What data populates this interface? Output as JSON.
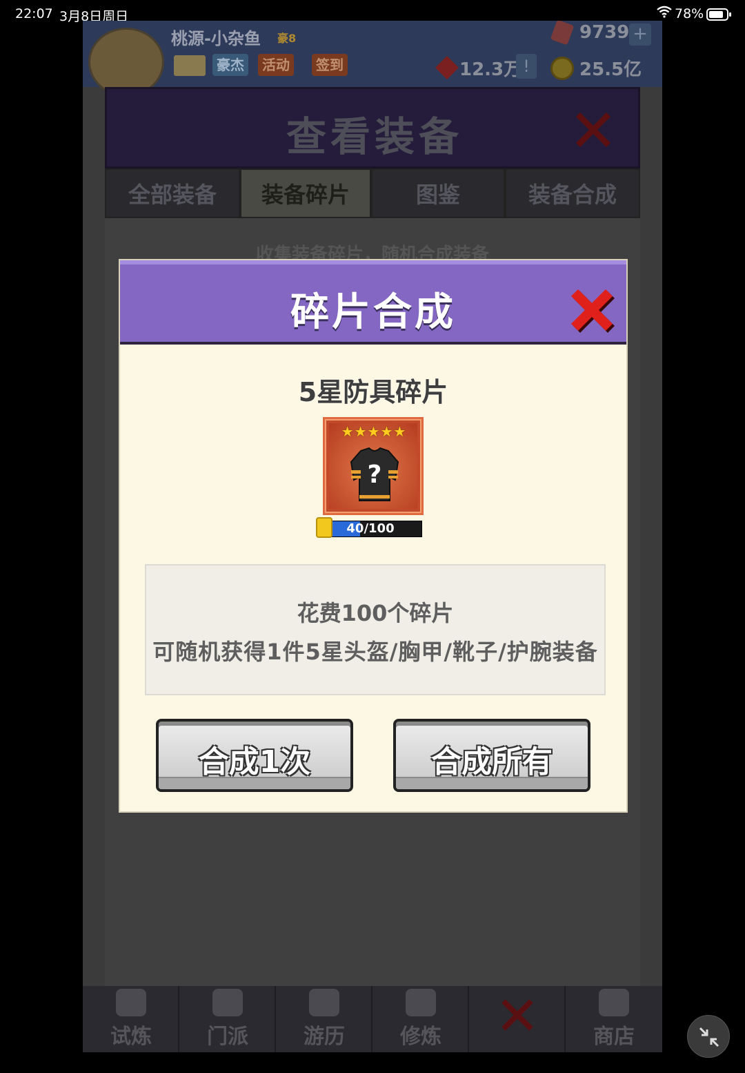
{
  "status_bar": {
    "time": "22:07",
    "date": "3月8日周日",
    "battery": "78%"
  },
  "header": {
    "player_name": "桃源-小杂鱼",
    "vip_badge": "豪8",
    "buttons": [
      "豪杰",
      "活动",
      "签到"
    ],
    "gems": "9739",
    "diamonds": "12.3万",
    "coins": "25.5亿",
    "plus_label": "+",
    "alert_label": "!"
  },
  "panel": {
    "title": "查看装备",
    "tabs": [
      "全部装备",
      "装备碎片",
      "图鉴",
      "装备合成"
    ],
    "active_tab": 1,
    "subtitle": "收集装备碎片，随机合成装备"
  },
  "modal": {
    "title": "碎片合成",
    "item_name": "5星防具碎片",
    "stars": "★★★★★",
    "mystery_mark": "?",
    "progress_text": "40/100",
    "progress_current": 40,
    "progress_total": 100,
    "description": {
      "line1": "花费100个碎片",
      "line2": "可随机获得1件5星头盔/胸甲/靴子/护腕装备"
    },
    "buttons": {
      "synthesize_once": "合成1次",
      "synthesize_all": "合成所有"
    }
  },
  "bottom_nav": {
    "items": [
      "试炼",
      "门派",
      "游历",
      "修炼",
      "",
      "商店"
    ]
  },
  "colors": {
    "modal_header": "#8367c3",
    "close_red": "#e0201a",
    "card_red": "#c24a2a",
    "progress_blue": "#2a6ad8"
  }
}
